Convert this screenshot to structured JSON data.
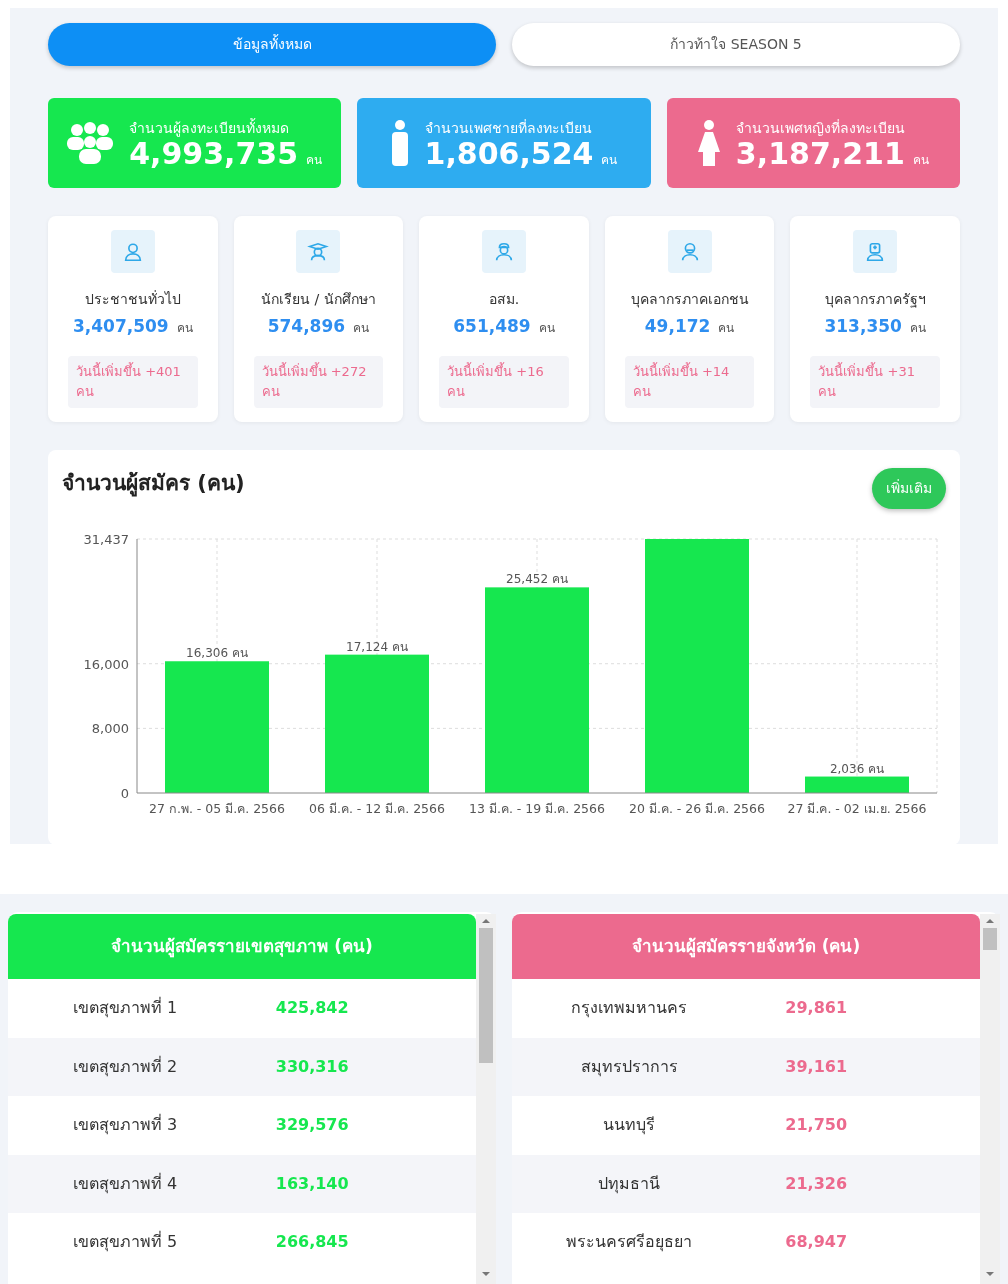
{
  "tabs": [
    {
      "label": "ข้อมูลทั้งหมด",
      "selected": true
    },
    {
      "label": "ก้าวท้าใจ SEASON 5",
      "selected": false
    }
  ],
  "totals": [
    {
      "kind": "all",
      "label": "จำนวนผู้ลงทะเบียนทั้งหมด",
      "value": "4,993,735",
      "unit": "คน",
      "color": "#16e74f"
    },
    {
      "kind": "male",
      "label": "จำนวนเพศชายที่ลงทะเบียน",
      "value": "1,806,524",
      "unit": "คน",
      "color": "#2eacf0"
    },
    {
      "kind": "female",
      "label": "จำนวนเพศหญิงที่ลงทะเบียน",
      "value": "3,187,211",
      "unit": "คน",
      "color": "#ec6a8e"
    }
  ],
  "groups": [
    {
      "kind": "person",
      "label": "ประชาชนทั่วไป",
      "value": "3,407,509",
      "unit": "คน",
      "today": "วันนี้เพิ่มขึ้น +401 คน"
    },
    {
      "kind": "student",
      "label": "นักเรียน / นักศึกษา",
      "value": "574,896",
      "unit": "คน",
      "today": "วันนี้เพิ่มขึ้น +272 คน"
    },
    {
      "kind": "volunteer",
      "label": "อสม.",
      "value": "651,489",
      "unit": "คน",
      "today": "วันนี้เพิ่มขึ้น +16 คน"
    },
    {
      "kind": "private",
      "label": "บุคลากรภาคเอกชน",
      "value": "49,172",
      "unit": "คน",
      "today": "วันนี้เพิ่มขึ้น +14 คน"
    },
    {
      "kind": "government",
      "label": "บุคลากรภาครัฐฯ",
      "value": "313,350",
      "unit": "คน",
      "today": "วันนี้เพิ่มขึ้น +31 คน"
    }
  ],
  "chart_panel": {
    "title": "จำนวนผู้สมัคร (คน)",
    "more_button": "เพิ่มเติม",
    "chart_data": {
      "type": "bar",
      "categories": [
        "27 ก.พ. - 05 มี.ค. 2566",
        "06 มี.ค. - 12 มี.ค. 2566",
        "13 มี.ค. - 19 มี.ค. 2566",
        "20 มี.ค. - 26 มี.ค. 2566",
        "27 มี.ค. - 02 เม.ย. 2566"
      ],
      "series": [
        {
          "color": "#16e74f",
          "values": [
            16306,
            17124,
            25452,
            31437,
            2036
          ]
        }
      ],
      "ylim": [
        0,
        31437
      ],
      "grid": true,
      "yticks": [
        {
          "value": 0,
          "label": "0"
        },
        {
          "value": 8000,
          "label": "8,000"
        },
        {
          "value": 16000,
          "label": "16,000"
        },
        {
          "value": 31437,
          "label": "31,437"
        }
      ],
      "value_labels": [
        "16,306 คน",
        "17,124 คน",
        "25,452 คน",
        null,
        "2,036 คน"
      ]
    }
  },
  "tables": [
    {
      "title": "จำนวนผู้สมัครรายเขตสุขภาพ (คน)",
      "color": "#16e74f",
      "rows": [
        [
          "เขตสุขภาพที่ 1",
          "425,842"
        ],
        [
          "เขตสุขภาพที่ 2",
          "330,316"
        ],
        [
          "เขตสุขภาพที่ 3",
          "329,576"
        ],
        [
          "เขตสุขภาพที่ 4",
          "163,140"
        ],
        [
          "เขตสุขภาพที่ 5",
          "266,845"
        ]
      ]
    },
    {
      "title": "จำนวนผู้สมัครรายจังหวัด (คน)",
      "color": "#ec6a8e",
      "rows": [
        [
          "กรุงเทพมหานคร",
          "29,861"
        ],
        [
          "สมุทรปราการ",
          "39,161"
        ],
        [
          "นนทบุรี",
          "21,750"
        ],
        [
          "ปทุมธานี",
          "21,326"
        ],
        [
          "พระนครศรีอยุธยา",
          "68,947"
        ]
      ]
    }
  ]
}
